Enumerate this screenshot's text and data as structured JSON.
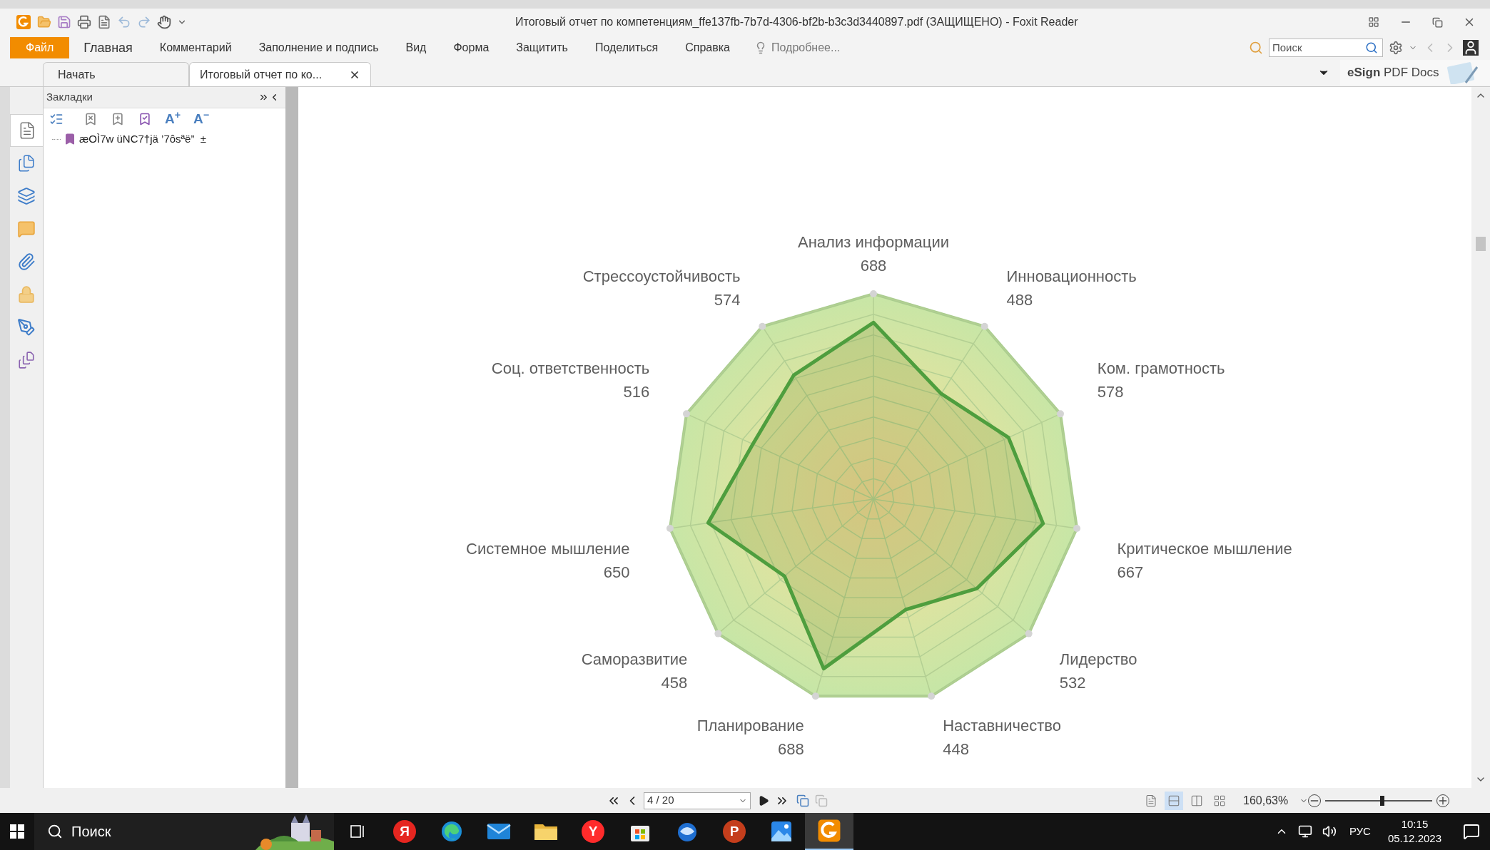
{
  "window": {
    "title": "Итоговый отчет по компетенциям_ffe137fb-7b7d-4306-bf2b-b3c3d3440897.pdf (ЗАЩИЩЕНО) - Foxit Reader"
  },
  "menu": [
    {
      "label": "Файл",
      "selected": true
    },
    {
      "label": "Главная",
      "selected": false
    },
    {
      "label": "Комментарий",
      "selected": false
    },
    {
      "label": "Заполнение и подпись",
      "selected": false
    },
    {
      "label": "Вид",
      "selected": false
    },
    {
      "label": "Форма",
      "selected": false
    },
    {
      "label": "Защитить",
      "selected": false
    },
    {
      "label": "Поделиться",
      "selected": false
    },
    {
      "label": "Справка",
      "selected": false
    }
  ],
  "tell_me": "Подробнее...",
  "search": {
    "placeholder": "Поиск"
  },
  "tabs": [
    {
      "label": "Начать",
      "selected": false,
      "closable": false
    },
    {
      "label": "Итоговый отчет по ко...",
      "selected": true,
      "closable": true
    }
  ],
  "esign": "**eSign** PDF Docs",
  "sidebar_tabs": [
    {
      "kind": "bookmarks",
      "selected": true
    },
    {
      "kind": "pages",
      "selected": false
    },
    {
      "kind": "layers",
      "selected": false
    },
    {
      "kind": "comments",
      "selected": false
    },
    {
      "kind": "attachments",
      "selected": false
    },
    {
      "kind": "security",
      "selected": false
    },
    {
      "kind": "signatures",
      "selected": false
    },
    {
      "kind": "info",
      "selected": false
    }
  ],
  "bookmarks": {
    "title": "Закладки",
    "text_tools": [
      "A$^{+}$",
      "A$^{−}$"
    ],
    "items": [
      {
        "label": "æOÌ7w üNC7†jä ’7ôsªë”  ±"
      }
    ]
  },
  "radar": {
    "left_axes": [
      {
        "label": "Стрессоустойчивость",
        "value": "574"
      },
      {
        "label": "Соц. ответственность",
        "value": "516"
      },
      {
        "label": "Системное мышление",
        "value": "650"
      },
      {
        "label": "Саморазвитие",
        "value": "458"
      },
      {
        "label": "Планирование",
        "value": "688"
      }
    ],
    "right_axes": [
      {
        "label": "Анализ информации",
        "value": "688"
      },
      {
        "label": "Инновационность",
        "value": "488"
      },
      {
        "label": "Ком. грамотность",
        "value": "578"
      },
      {
        "label": "Критическое мышление",
        "value": "667"
      },
      {
        "label": "Лидерство",
        "value": "532"
      },
      {
        "label": "Наставничество",
        "value": "448"
      }
    ]
  },
  "nav": {
    "page": "4 / 20",
    "zoom": "160,63%",
    "zoom_slider": {
      "level": 0.53
    },
    "view_modes": [
      {
        "kind": "single",
        "selected": false
      },
      {
        "kind": "continuous",
        "selected": true
      },
      {
        "kind": "facing",
        "selected": false
      },
      {
        "kind": "split",
        "selected": false
      }
    ]
  },
  "taskbar": {
    "search": {
      "placeholder": "Поиск"
    },
    "apps": [
      {
        "kind": "taskview",
        "selected": false
      },
      {
        "kind": "letter",
        "label": "Я",
        "color": "#e52620",
        "selected": false
      },
      {
        "kind": "edge",
        "selected": false
      },
      {
        "kind": "mail",
        "selected": false
      },
      {
        "kind": "folder",
        "selected": false
      },
      {
        "kind": "letter",
        "label": "Y",
        "color": "#ff2b2b",
        "selected": false
      },
      {
        "kind": "store",
        "selected": false
      },
      {
        "kind": "bird",
        "selected": false
      },
      {
        "kind": "letter",
        "label": "P",
        "color": "#c43e1c",
        "selected": false
      },
      {
        "kind": "photos",
        "selected": false
      },
      {
        "kind": "foxit",
        "selected": true
      }
    ],
    "tray": {
      "language": "РУС",
      "time": "10:15",
      "date": "05.12.2023"
    }
  }
}
